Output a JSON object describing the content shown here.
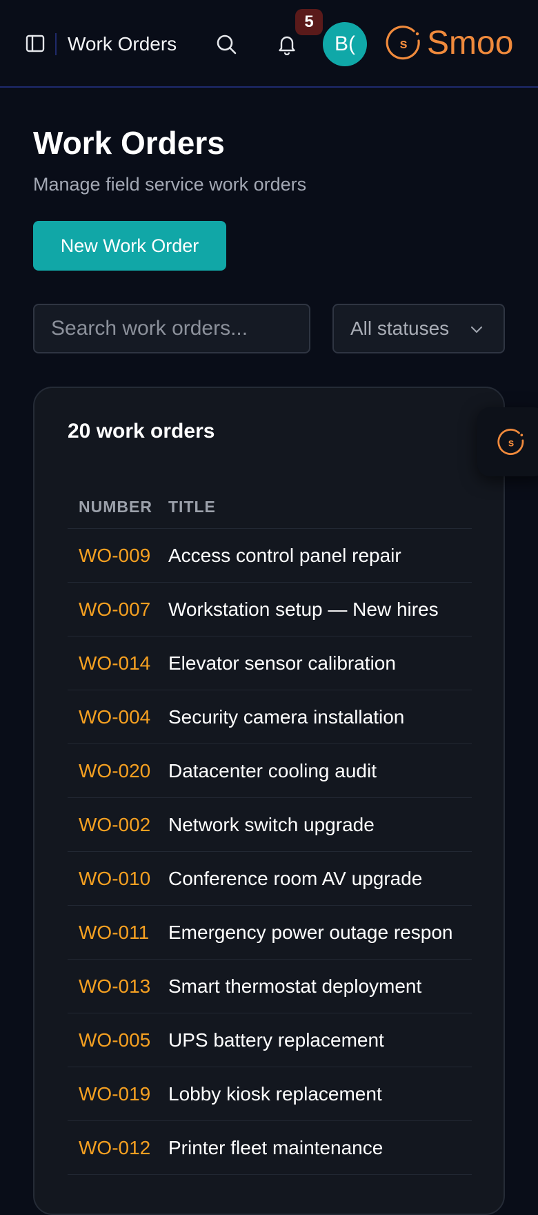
{
  "header": {
    "title": "Work Orders",
    "notification_count": "5",
    "avatar_initials": "B(",
    "brand_name": "Smoo",
    "brand_logo_letter": "s"
  },
  "page": {
    "title": "Work Orders",
    "subtitle": "Manage field service work orders",
    "new_button_label": "New Work Order"
  },
  "filters": {
    "search_placeholder": "Search work orders...",
    "status_value": "All statuses"
  },
  "table": {
    "summary": "20 work orders",
    "columns": [
      "NUMBER",
      "TITLE"
    ],
    "rows": [
      {
        "number": "WO-009",
        "title": "Access control panel repair"
      },
      {
        "number": "WO-007",
        "title": "Workstation setup — New hires"
      },
      {
        "number": "WO-014",
        "title": "Elevator sensor calibration"
      },
      {
        "number": "WO-004",
        "title": "Security camera installation"
      },
      {
        "number": "WO-020",
        "title": "Datacenter cooling audit"
      },
      {
        "number": "WO-002",
        "title": "Network switch upgrade"
      },
      {
        "number": "WO-010",
        "title": "Conference room AV upgrade"
      },
      {
        "number": "WO-011",
        "title": "Emergency power outage respon"
      },
      {
        "number": "WO-013",
        "title": "Smart thermostat deployment"
      },
      {
        "number": "WO-005",
        "title": "UPS battery replacement"
      },
      {
        "number": "WO-019",
        "title": "Lobby kiosk replacement"
      },
      {
        "number": "WO-012",
        "title": "Printer fleet maintenance"
      }
    ]
  },
  "colors": {
    "background": "#090d18",
    "accent_teal": "#11a7a7",
    "order_number": "#f5a021",
    "brand_orange": "#f08a3c",
    "badge": "#5a1a1a"
  },
  "icons": [
    "sidebar-toggle-icon",
    "search-icon",
    "bell-icon",
    "chevron-down-icon",
    "brand-logo-icon"
  ]
}
